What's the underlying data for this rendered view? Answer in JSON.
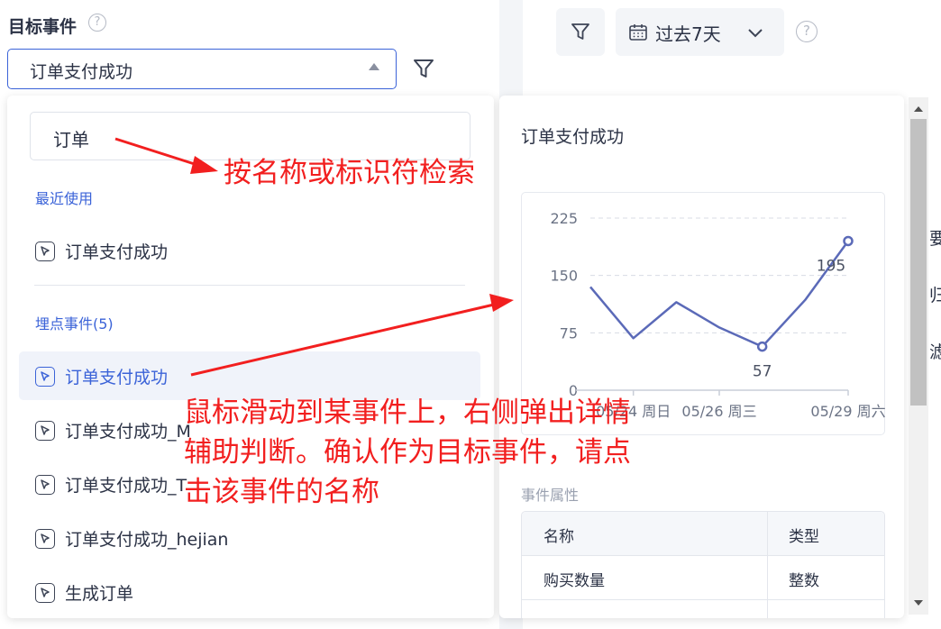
{
  "header": {
    "target_label": "目标事件",
    "help_glyph": "?",
    "selected_event": "订单支付成功",
    "date_range": "过去7天"
  },
  "dropdown": {
    "search_value": "订单",
    "recent_title": "最近使用",
    "recent_items": [
      "订单支付成功"
    ],
    "tracked_title": "埋点事件(5)",
    "tracked_items": [
      "订单支付成功",
      "订单支付成功_M",
      "订单支付成功_T",
      "订单支付成功_hejian",
      "生成订单"
    ],
    "active_index": 0
  },
  "detail": {
    "title": "订单支付成功",
    "props_title": "事件属性",
    "props_headers": [
      "名称",
      "类型"
    ],
    "props_rows": [
      [
        "购买数量",
        "整数"
      ]
    ]
  },
  "chart_data": {
    "type": "line",
    "title": "",
    "yticks": [
      "225",
      "150",
      "75",
      "0"
    ],
    "ylim": [
      0,
      225
    ],
    "xtick_labels": [
      "05/24 周日",
      "05/26 周三",
      "05/29 周六"
    ],
    "x": [
      "05/23",
      "05/24",
      "05/25",
      "05/26",
      "05/27",
      "05/28",
      "05/29"
    ],
    "values": [
      135,
      68,
      115,
      82,
      57,
      118,
      195
    ],
    "data_labels": [
      "57",
      "195"
    ],
    "color": "#5b6ab8",
    "grid": true
  },
  "right_edge_chars": [
    "要",
    "归",
    "滤"
  ],
  "annotations": {
    "search_hint": "按名称或标识符检索",
    "hover_hint_lines": [
      "鼠标滑动到某事件上，右侧弹出详情",
      "辅助判断。确认作为目标事件，请点",
      "击该事件的名称"
    ],
    "color": "#f21f1f"
  }
}
